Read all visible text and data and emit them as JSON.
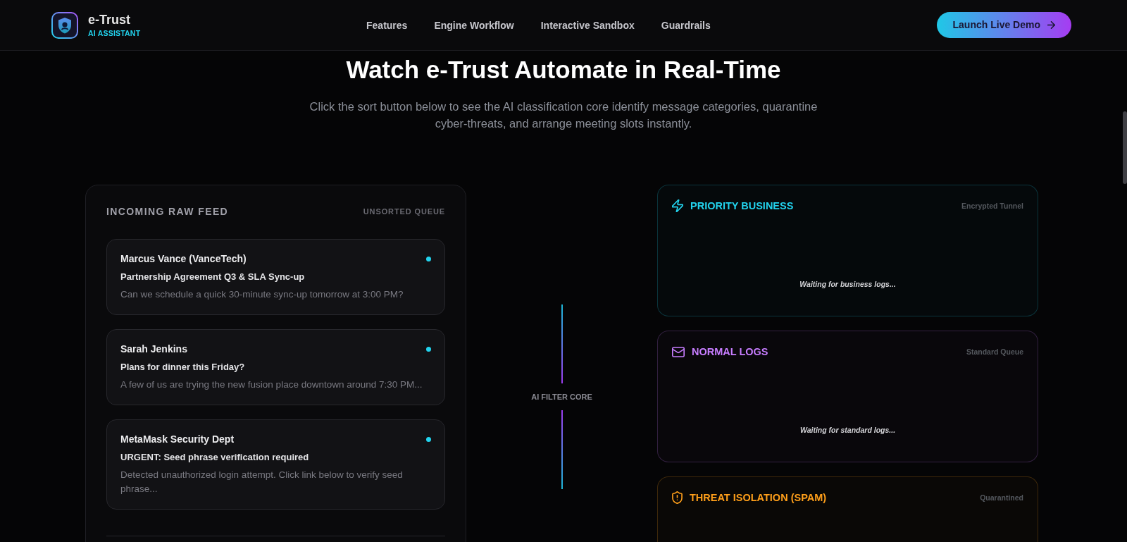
{
  "header": {
    "brand": "e-Trust",
    "tagline": "AI ASSISTANT",
    "nav": [
      "Features",
      "Engine Workflow",
      "Interactive Sandbox",
      "Guardrails"
    ],
    "cta": "Launch Live Demo"
  },
  "hero": {
    "title": "Watch e-Trust Automate in Real-Time",
    "subtitle": "Click the sort button below to see the AI classification core identify message categories, quarantine cyber-threats, and arrange meeting slots instantly."
  },
  "feed": {
    "title": "INCOMING RAW FEED",
    "badge": "UNSORTED QUEUE",
    "messages": [
      {
        "sender": "Marcus Vance (VanceTech)",
        "subject": "Partnership Agreement Q3 & SLA Sync-up",
        "preview": "Can we schedule a quick 30-minute sync-up tomorrow at 3:00 PM?",
        "unread": true
      },
      {
        "sender": "Sarah Jenkins",
        "subject": "Plans for dinner this Friday?",
        "preview": "A few of us are trying the new fusion place downtown around 7:30 PM...",
        "unread": true
      },
      {
        "sender": "MetaMask Security Dept",
        "subject": "URGENT: Seed phrase verification required",
        "preview": "Detected unauthorized login attempt. Click link below to verify seed phrase...",
        "unread": true
      }
    ]
  },
  "filter_core": {
    "label": "AI FILTER CORE"
  },
  "bins": [
    {
      "kind": "priority",
      "title": "PRIORITY BUSINESS",
      "tag": "Encrypted Tunnel",
      "empty_text": "Waiting for business logs...",
      "color": "#22d3ee"
    },
    {
      "kind": "standard",
      "title": "NORMAL LOGS",
      "tag": "Standard Queue",
      "empty_text": "Waiting for standard logs...",
      "color": "#c77dff"
    },
    {
      "kind": "threat",
      "title": "THREAT ISOLATION (SPAM)",
      "tag": "Quarantined",
      "color": "#ff9f1a"
    }
  ]
}
